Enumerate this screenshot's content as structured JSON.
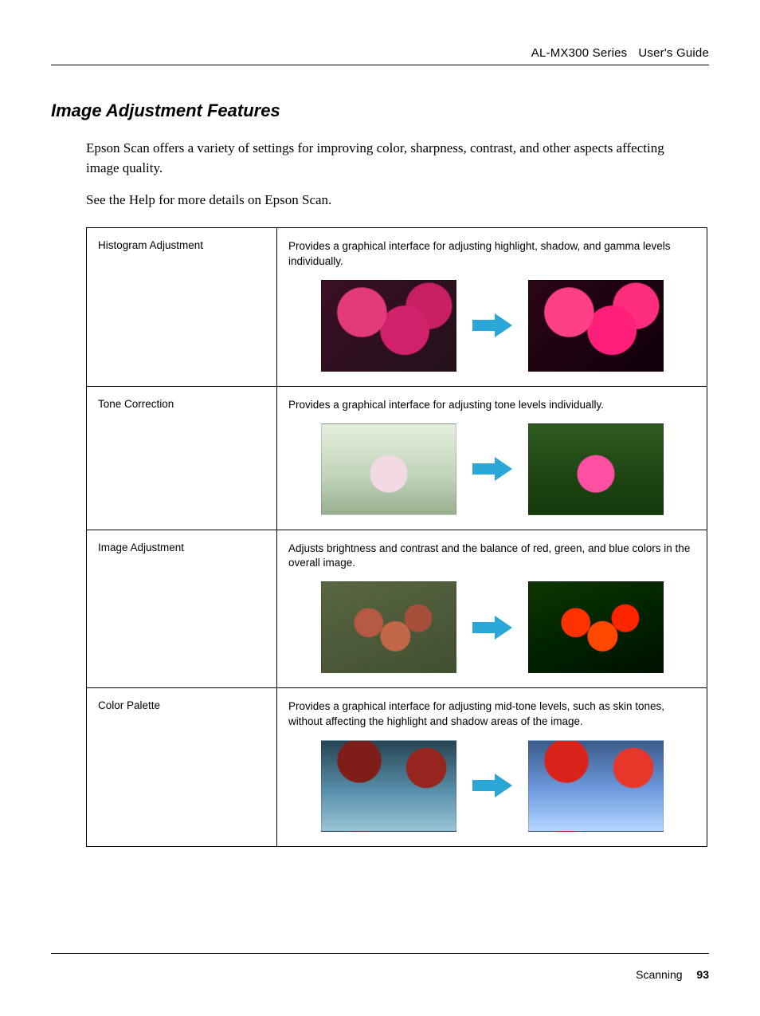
{
  "header": {
    "product": "AL-MX300 Series",
    "doc_type": "User's Guide"
  },
  "section_title": "Image Adjustment Features",
  "intro": "Epson Scan offers a variety of settings for improving color, sharpness, contrast, and other aspects affecting image quality.",
  "note": "See the Help for more details on Epson Scan.",
  "rows": [
    {
      "name": "Histogram Adjustment",
      "desc": "Provides a graphical interface for adjusting highlight, shadow, and gamma levels individually.",
      "before_alt": "dull magenta flowers before histogram adjustment",
      "after_alt": "vivid magenta flowers after histogram adjustment",
      "before_class": "bg-hist-a",
      "after_class": "bg-hist-b"
    },
    {
      "name": "Tone Correction",
      "desc": "Provides a graphical interface for adjusting tone levels individually.",
      "before_alt": "washed-out pink flower on pale green foliage",
      "after_alt": "saturated pink flower on dark green foliage",
      "before_class": "bg-tone-a",
      "after_class": "bg-tone-b"
    },
    {
      "name": "Image Adjustment",
      "desc": "Adjusts brightness and contrast and the balance of red, green, and blue colors in the overall image.",
      "before_alt": "low-contrast photo of tomatoes and greens",
      "after_alt": "high-contrast corrected photo of tomatoes and greens",
      "before_class": "bg-img-a",
      "after_class": "bg-img-b"
    },
    {
      "name": "Color Palette",
      "desc": "Provides a graphical interface for adjusting mid-tone levels, such as skin tones, without affecting the highlight and shadow areas of the image.",
      "before_alt": "red maple leaves against muted sky",
      "after_alt": "red maple leaves against brighter blue sky",
      "before_class": "bg-pal-a",
      "after_class": "bg-pal-b"
    }
  ],
  "arrow_color": "#2aa7d6",
  "footer": {
    "chapter": "Scanning",
    "page": "93"
  }
}
